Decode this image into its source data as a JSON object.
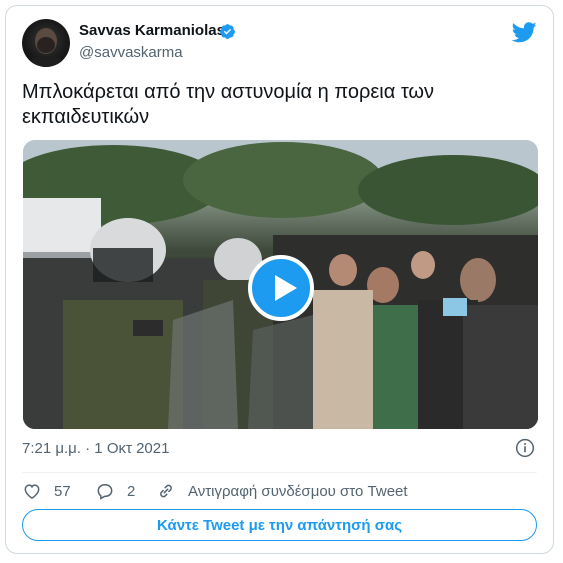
{
  "tweet": {
    "author_name": "Savvas Karmaniolas",
    "author_handle": "@savvaskarma",
    "text": "Μπλοκάρεται από την αστυνομία η πορεια των εκπαιδευτικών",
    "timestamp": "7:21 μ.μ. · 1 Οκτ 2021",
    "likes": "57",
    "replies": "2",
    "copy_link_label": "Αντιγραφή συνδέσμου στο Tweet",
    "reply_button_label": "Κάντε Tweet με την απάντησή σας"
  },
  "icons": {
    "verified": "verified-badge-icon",
    "brand": "twitter-bird-icon",
    "info": "info-icon",
    "like": "heart-icon",
    "reply": "reply-bubble-icon",
    "copy": "link-icon",
    "play": "play-icon"
  },
  "colors": {
    "accent": "#1d9bf0",
    "text": "#0f1419",
    "secondary": "#536471",
    "border": "#cfd9de"
  }
}
